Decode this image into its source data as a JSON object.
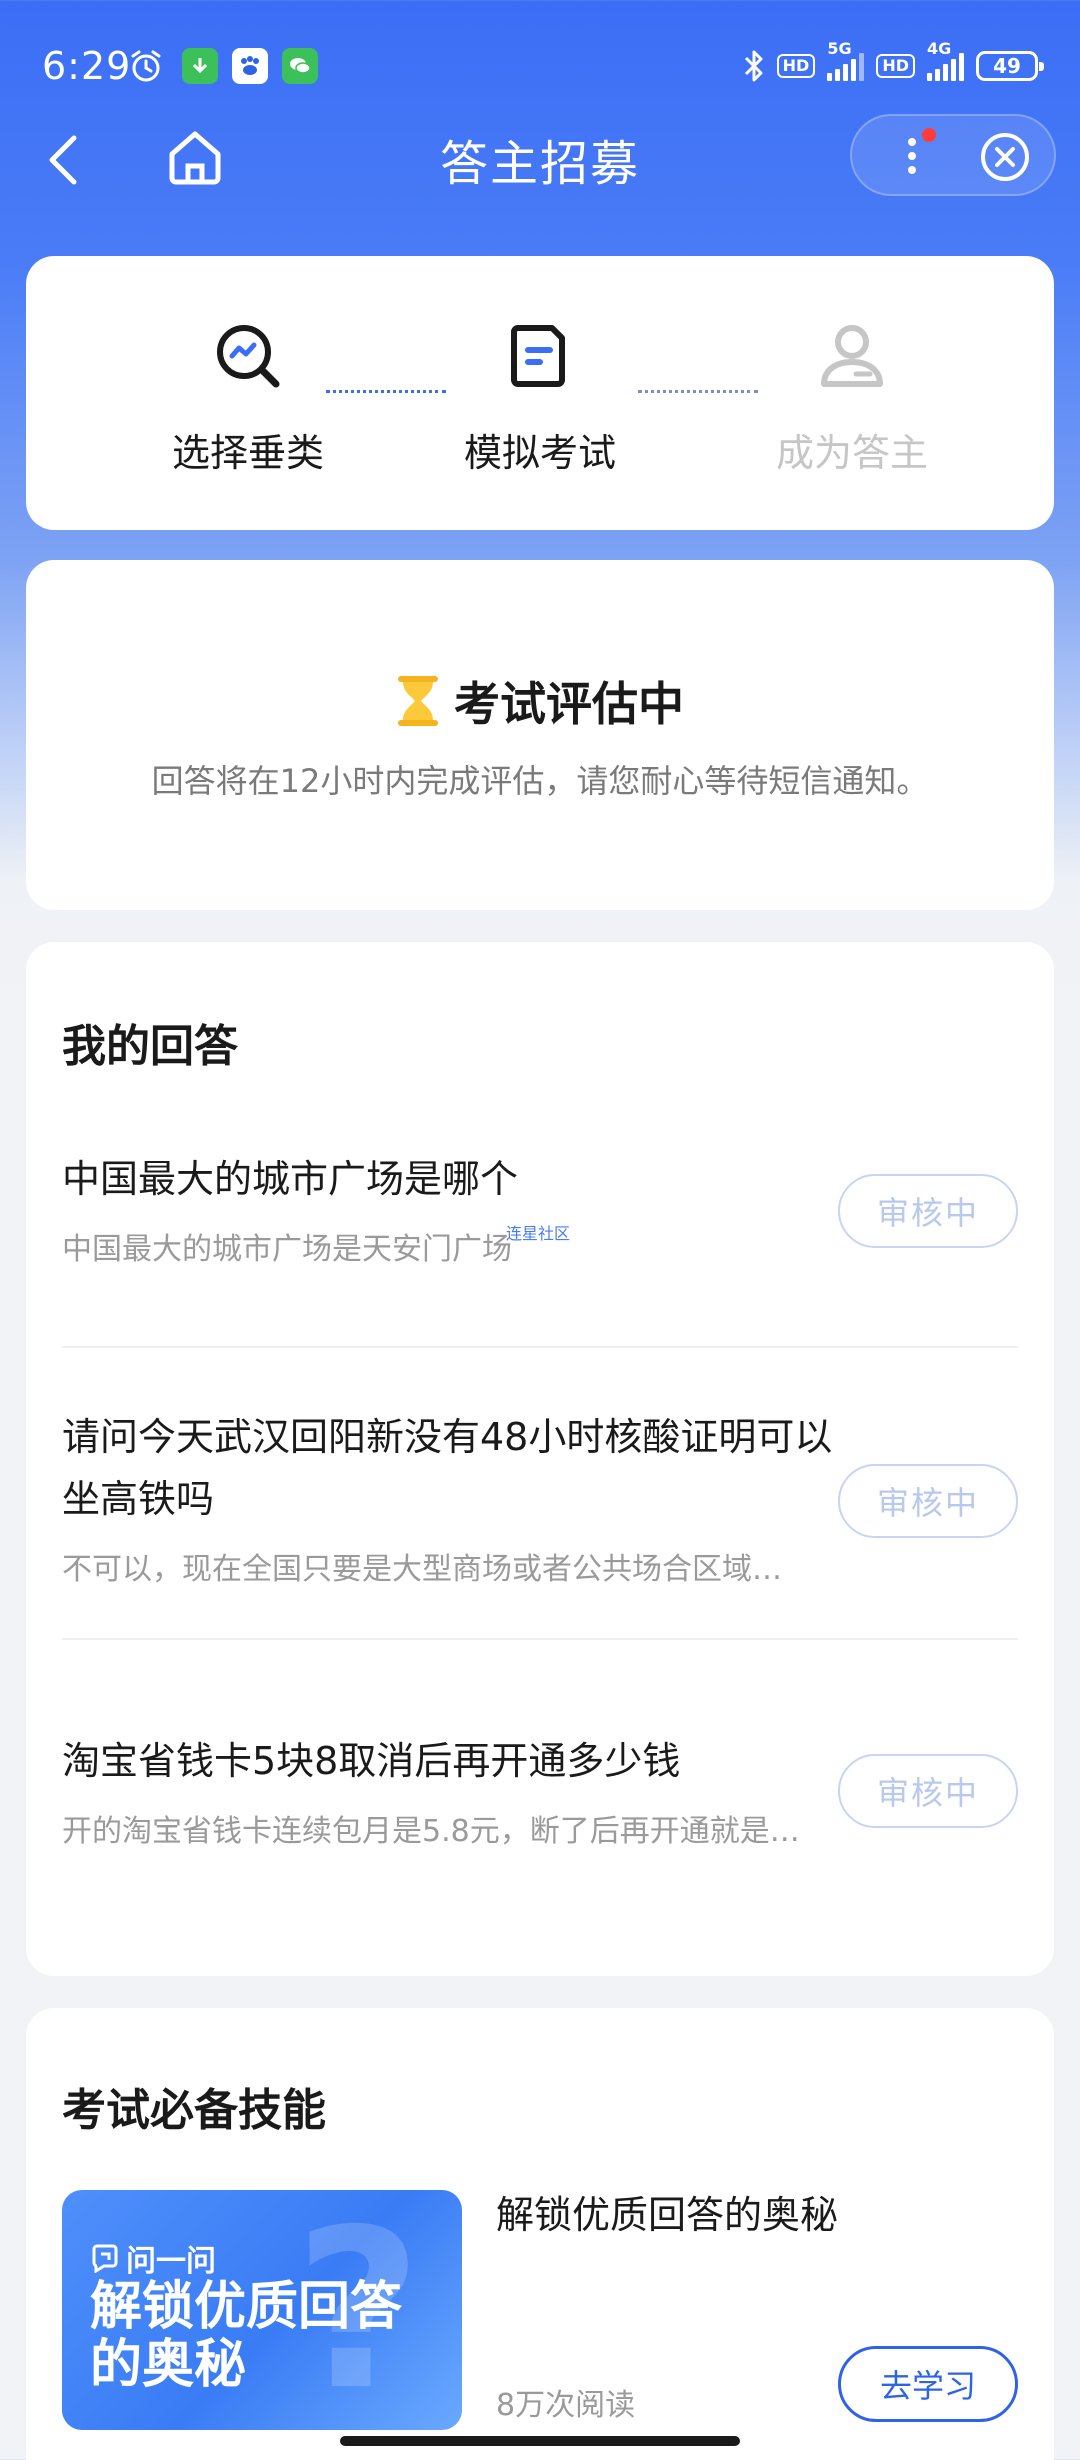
{
  "status_bar": {
    "time": "6:29",
    "hd1": "HD",
    "net1": "5G",
    "hd2": "HD",
    "net2": "4G",
    "battery": "49"
  },
  "nav": {
    "title": "答主招募"
  },
  "steps": [
    {
      "label": "选择垂类",
      "state": "done"
    },
    {
      "label": "模拟考试",
      "state": "current"
    },
    {
      "label": "成为答主",
      "state": "pending"
    }
  ],
  "status": {
    "title": "考试评估中",
    "description": "回答将在12小时内完成评估，请您耐心等待短信通知。"
  },
  "answers": {
    "title": "我的回答",
    "watermark": "连星社区",
    "items": [
      {
        "question": "中国最大的城市广场是哪个",
        "answer": "中国最大的城市广场是天安门广场",
        "status": "审核中"
      },
      {
        "question": "请问今天武汉回阳新没有48小时核酸证明可以坐高铁吗",
        "answer": "不可以，现在全国只要是大型商场或者公共场合区域…",
        "status": "审核中"
      },
      {
        "question": "淘宝省钱卡5块8取消后再开通多少钱",
        "answer": "开的淘宝省钱卡连续包月是5.8元，断了后再开通就是…",
        "status": "审核中"
      }
    ]
  },
  "skills": {
    "title": "考试必备技能",
    "item": {
      "thumb_brand": "问一问",
      "thumb_text": "解锁优质回答的奥秘",
      "title": "解锁优质回答的奥秘",
      "reads": "8万次阅读",
      "button": "去学习"
    }
  },
  "colors": {
    "primary": "#3b6ef5",
    "badge_border": "#c7d4f3",
    "muted_text": "#9a9a9a"
  }
}
